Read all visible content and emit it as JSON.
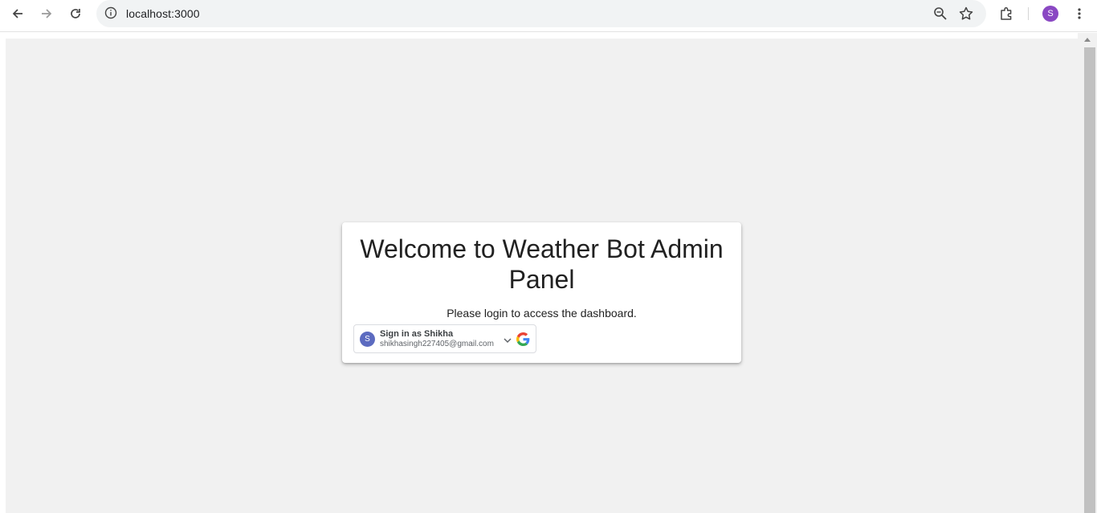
{
  "browser": {
    "url": "localhost:3000",
    "profile_initial": "S"
  },
  "login": {
    "title": "Welcome to Weather Bot Admin Panel",
    "subtitle": "Please login to access the dashboard.",
    "google_button": {
      "avatar_initial": "S",
      "label": "Sign in as Shikha",
      "email": "shikhasingh227405@gmail.com"
    }
  },
  "colors": {
    "page_background": "#f1f1f1",
    "profile_avatar": "#8a48c3",
    "gsi_avatar": "#5c6bc0"
  }
}
